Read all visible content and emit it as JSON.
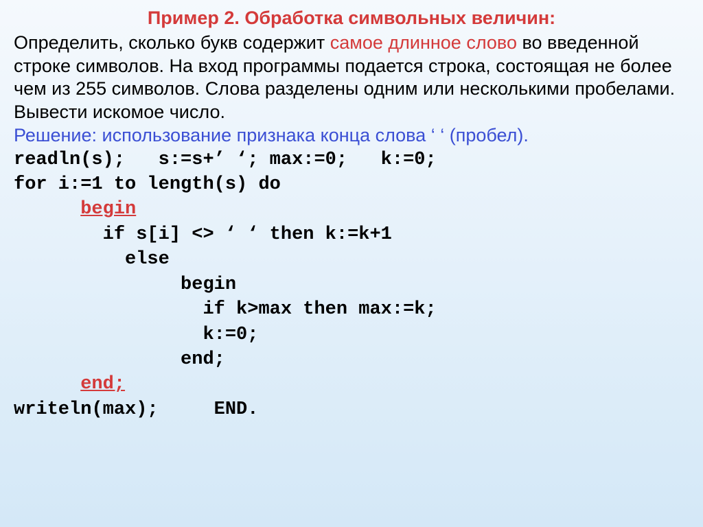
{
  "title": "Пример 2. Обработка символьных величин:",
  "p1_a": "Определить, сколько букв содержит ",
  "p1_red": "самое длинное слово",
  "p1_b": " во введенной строке символов. На вход программы подается строка, состоящая не более чем из 255 символов. Слова разделены одним или несколькими пробелами. Вывести искомое число.",
  "p2": "Решение: использование признака конца слова ‘ ‘ (пробел).",
  "code": {
    "l1": "readln(s);   s:=s+’ ‘; max:=0;   k:=0;",
    "l2": "for i:=1 to length(s) do",
    "l3_pad": "      ",
    "l3_kw": "begin",
    "l4": "        if s[i] <> ‘ ‘ then k:=k+1",
    "l5": "          else",
    "l6": "               begin",
    "l7": "                 if k>max then max:=k;",
    "l8": "                 k:=0;",
    "l9": "               end;",
    "l10_pad": "      ",
    "l10_kw": "end;",
    "l11": "writeln(max);     END."
  }
}
